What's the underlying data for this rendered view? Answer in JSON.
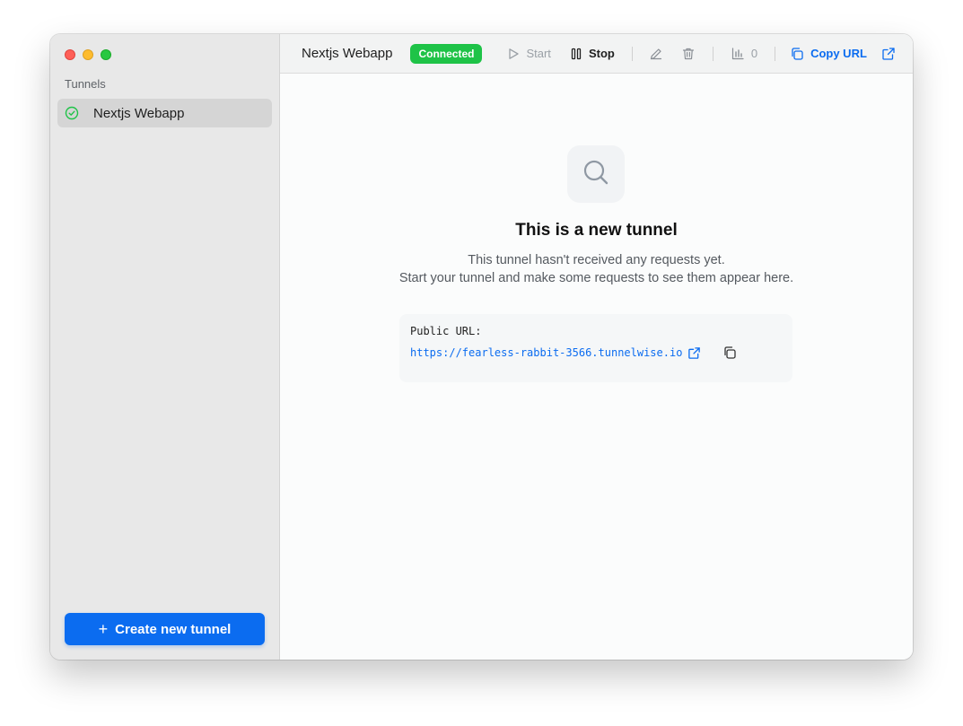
{
  "sidebar": {
    "heading": "Tunnels",
    "items": [
      {
        "label": "Nextjs Webapp",
        "status_icon": "check-circle-icon",
        "selected": true
      }
    ],
    "create_button": {
      "icon": "plus-icon",
      "label": "Create new tunnel"
    }
  },
  "toolbar": {
    "title": "Nextjs Webapp",
    "status_badge": "Connected",
    "start_label": "Start",
    "stop_label": "Stop",
    "request_count": "0",
    "copy_url_label": "Copy URL"
  },
  "empty_state": {
    "icon": "search-icon",
    "title": "This is a new tunnel",
    "line1": "This tunnel hasn't received any requests yet.",
    "line2": "Start your tunnel and make some requests to see them appear here."
  },
  "public_url": {
    "label": "Public URL:",
    "url": "https://fearless-rabbit-3566.tunnelwise.io"
  },
  "colors": {
    "accent": "#0b6cf0",
    "connected": "#1ec347",
    "sidebar_bg": "#e8e8e8",
    "selected_bg": "#d5d5d5"
  }
}
